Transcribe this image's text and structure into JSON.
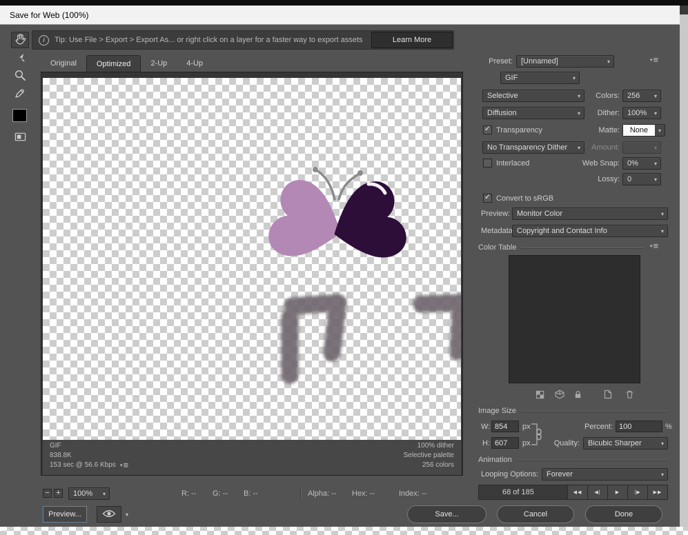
{
  "window": {
    "title": "Save for Web (100%)"
  },
  "icons": {
    "chevron": "▾",
    "check": "✓",
    "info": "i",
    "menu": "≡",
    "menu_arrow": "▾",
    "minus": "−",
    "plus": "+"
  },
  "tip": {
    "text": "Tip: Use File > Export > Export As...  or right click on a layer for a faster way to export assets",
    "learn_more": "Learn More"
  },
  "tabs": [
    {
      "label": "Original"
    },
    {
      "label": "Optimized"
    },
    {
      "label": "2-Up"
    },
    {
      "label": "4-Up"
    }
  ],
  "preview": {
    "status_left": [
      "GIF",
      "838.8K",
      "153 sec @ 56.6 Kbps"
    ],
    "status_right": [
      "100% dither",
      "Selective palette",
      "256 colors"
    ]
  },
  "settings": {
    "preset_label": "Preset:",
    "preset_value": "[Unnamed]",
    "format": "GIF",
    "reduction": "Selective",
    "colors_label": "Colors:",
    "colors": "256",
    "dither_method": "Diffusion",
    "dither_label": "Dither:",
    "dither": "100%",
    "transparency": "Transparency",
    "matte_label": "Matte:",
    "matte": "None",
    "transparency_dither": "No Transparency Dither",
    "amount_label": "Amount:",
    "interlaced": "Interlaced",
    "web_snap_label": "Web Snap:",
    "web_snap": "0%",
    "lossy_label": "Lossy:",
    "lossy": "0",
    "convert_srgb": "Convert to sRGB",
    "preview_label": "Preview:",
    "preview": "Monitor Color",
    "metadata_label": "Metadata:",
    "metadata": "Copyright and Contact Info"
  },
  "color_table": {
    "title": "Color Table"
  },
  "image_size": {
    "title": "Image Size",
    "w_label": "W:",
    "w": "854",
    "h_label": "H:",
    "h": "607",
    "unit": "px",
    "percent_label": "Percent:",
    "percent": "100",
    "percent_unit": "%",
    "quality_label": "Quality:",
    "quality": "Bicubic Sharper"
  },
  "animation": {
    "title": "Animation",
    "looping_label": "Looping Options:",
    "looping_value": "Forever",
    "frame_status": "68 of 185",
    "playback": [
      "◀◀",
      "◀|",
      "▶",
      "|▶",
      "▶▶"
    ]
  },
  "statusbar": {
    "zoom": "100%",
    "readouts": [
      "R: --",
      "G: --",
      "B: --",
      "Alpha: --",
      "Hex: --",
      "Index: --"
    ]
  },
  "footer": {
    "preview": "Preview...",
    "save": "Save...",
    "cancel": "Cancel",
    "done": "Done"
  },
  "artwork": {
    "wing_left_color": "#b388b5",
    "wing_right_color": "#2d0e39",
    "antenna_color": "#8b8b8b",
    "letters_color": "#6f686e"
  }
}
